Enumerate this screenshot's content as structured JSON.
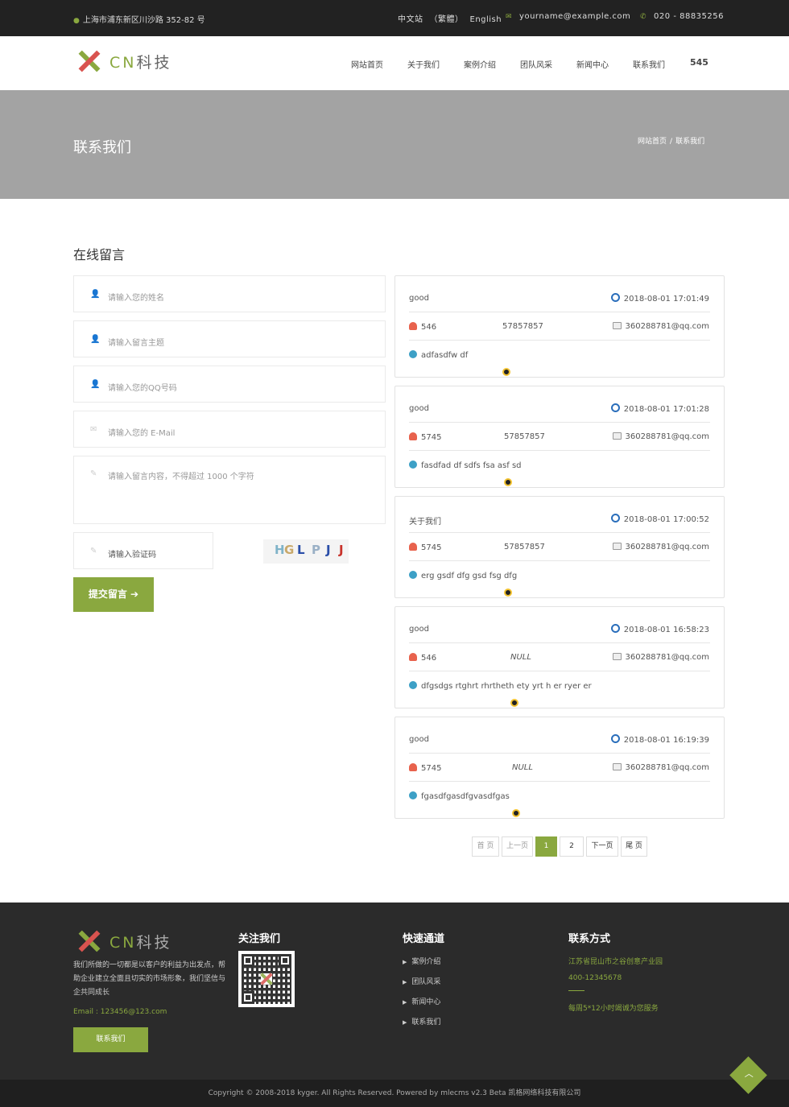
{
  "topbar": {
    "address": "上海市浦东新区川沙路 352-82 号",
    "lang_cn": "中文站",
    "lang_tw": "（繁體）",
    "lang_en": "English",
    "email": "yourname@example.com",
    "phone": "020 - 88835256"
  },
  "logo": {
    "brand": "CN",
    "name": "科技"
  },
  "nav": [
    "网站首页",
    "关于我们",
    "案例介绍",
    "团队风采",
    "新闻中心",
    "联系我们",
    "545"
  ],
  "banner": {
    "title": "联系我们",
    "breadcrumb": [
      "网站首页",
      "联系我们"
    ],
    "sep": "/"
  },
  "form": {
    "title": "在线留言",
    "name_ph": "请输入您的姓名",
    "subject_ph": "请输入留言主题",
    "qq_ph": "请输入您的QQ号码",
    "email_ph": "请输入您的 E-Mail",
    "content_ph": "请输入留言内容，不得超过 1000 个字符",
    "captcha_ph": "请输入验证码",
    "captcha_text": [
      "H",
      "G",
      "L",
      "P",
      "J",
      "J"
    ],
    "submit": "提交留言 ➔"
  },
  "messages": [
    {
      "subject": "good",
      "time": "2018-08-01 17:01:49",
      "name": "546",
      "qq": "57857857",
      "email": "360288781@qq.com",
      "content": "adfasdfw df"
    },
    {
      "subject": "good",
      "time": "2018-08-01 17:01:28",
      "name": "5745",
      "qq": "57857857",
      "email": "360288781@qq.com",
      "content": "fasdfad df sdfs fsa asf sd"
    },
    {
      "subject": "关于我们",
      "time": "2018-08-01 17:00:52",
      "name": "5745",
      "qq": "57857857",
      "email": "360288781@qq.com",
      "content": "erg gsdf dfg gsd fsg dfg"
    },
    {
      "subject": "good",
      "time": "2018-08-01 16:58:23",
      "name": "546",
      "qq": "NULL",
      "email": "360288781@qq.com",
      "content": "dfgsdgs rtghrt rhrtheth ety yrt h er ryer er"
    },
    {
      "subject": "good",
      "time": "2018-08-01 16:19:39",
      "name": "5745",
      "qq": "NULL",
      "email": "360288781@qq.com",
      "content": "fgasdfgasdfgvasdfgas"
    }
  ],
  "pager": {
    "first": "首 页",
    "prev": "上一页",
    "p1": "1",
    "p2": "2",
    "next": "下一页",
    "last": "尾 页"
  },
  "footer": {
    "desc": "我们所做的一切都是以客户的利益为出发点，帮助企业建立全面且切实的市场形象，我们坚信与企共同成长",
    "email": "Email : 123456@123.com",
    "contact_btn": "联系我们",
    "follow_title": "关注我们",
    "quick_title": "快速通道",
    "quick_links": [
      "案例介绍",
      "团队风采",
      "新闻中心",
      "联系我们"
    ],
    "contact_title": "联系方式",
    "address": "江苏省昆山市之谷创意产业园",
    "phone": "400-12345678",
    "hours": "每周5*12小时竭诚为您服务",
    "copyright": "Copyright © 2008-2018 kyger. All Rights Reserved. Powered by mlecms v2.3 Beta 凯格网络科技有限公司"
  },
  "colors": {
    "accent": "#8aa83f",
    "topbar": "#222222",
    "banner": "#a3a3a3",
    "footer": "#2b2b2b"
  }
}
